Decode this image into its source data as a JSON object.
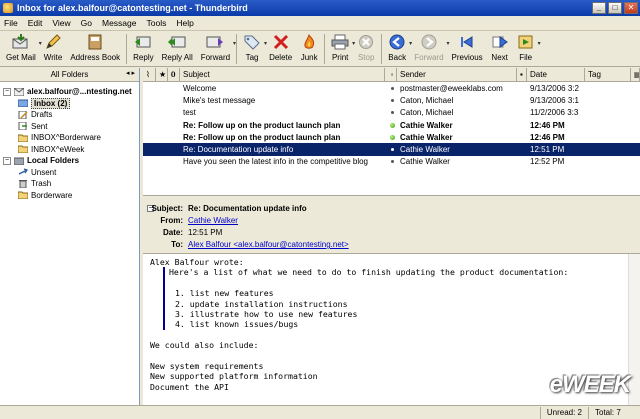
{
  "window": {
    "title": "Inbox for alex.balfour@catontesting.net - Thunderbird",
    "min": "_",
    "max": "□",
    "close": "✕"
  },
  "menu": [
    "File",
    "Edit",
    "View",
    "Go",
    "Message",
    "Tools",
    "Help"
  ],
  "toolbar": {
    "get_mail": "Get Mail",
    "write": "Write",
    "address_book": "Address Book",
    "reply": "Reply",
    "reply_all": "Reply All",
    "forward": "Forward",
    "tag": "Tag",
    "delete": "Delete",
    "junk": "Junk",
    "print": "Print",
    "stop": "Stop",
    "back": "Back",
    "forward_nav": "Forward",
    "previous": "Previous",
    "next": "Next",
    "file": "File"
  },
  "folder_pane": {
    "header": "All Folders",
    "arrows": "◂ ▸",
    "account": "alex.balfour@...ntesting.net",
    "folders": [
      "Inbox (2)",
      "Drafts",
      "Sent",
      "INBOX^Borderware",
      "INBOX^eWeek"
    ],
    "local_header": "Local Folders",
    "local_folders": [
      "Unsent",
      "Trash",
      "Borderware"
    ]
  },
  "message_list": {
    "columns": {
      "subject": "Subject",
      "sender": "Sender",
      "date": "Date",
      "tag": "Tag"
    },
    "rows": [
      {
        "subject": "Welcome",
        "sender": "postmaster@eweeklabs.com",
        "date": "9/13/2006 3:2",
        "unread": false,
        "selected": false,
        "green": false
      },
      {
        "subject": "Mike's test message",
        "sender": "Caton, Michael",
        "date": "9/13/2006 3:1",
        "unread": false,
        "selected": false,
        "green": false
      },
      {
        "subject": "test",
        "sender": "Caton, Michael",
        "date": "11/2/2006 3:3",
        "unread": false,
        "selected": false,
        "green": false
      },
      {
        "subject": "Re: Follow up on the product launch plan",
        "sender": "Cathie Walker",
        "date": "12:46 PM",
        "unread": true,
        "selected": false,
        "green": true
      },
      {
        "subject": "Re: Follow up on the product launch plan",
        "sender": "Cathie Walker",
        "date": "12:46 PM",
        "unread": true,
        "selected": false,
        "green": true
      },
      {
        "subject": "Re: Documentation update info",
        "sender": "Cathie Walker",
        "date": "12:51 PM",
        "unread": false,
        "selected": true,
        "green": false
      },
      {
        "subject": "Have you seen the latest info in the competitive blog",
        "sender": "Cathie Walker",
        "date": "12:52 PM",
        "unread": false,
        "selected": false,
        "green": false
      }
    ]
  },
  "header": {
    "subject_label": "Subject:",
    "subject": "Re: Documentation update info",
    "from_label": "From:",
    "from": "Cathie Walker",
    "date_label": "Date:",
    "date": "12:51 PM",
    "to_label": "To:",
    "to": "Alex Balfour <alex.balfour@catontesting.net>"
  },
  "body": {
    "intro": "Alex Balfour wrote:",
    "quote": [
      "Here's a list of what we need to do to finish updating the product documentation:",
      "",
      "1. list new features",
      "2. update installation instructions",
      "3. illustrate how to use new features",
      "4. list known issues/bugs"
    ],
    "after": [
      "",
      "We could also include:",
      "",
      "New system requirements",
      "New supported platform information",
      "Document the API"
    ]
  },
  "status": {
    "unread": "Unread: 2",
    "total": "Total: 7"
  },
  "watermark": "eWEEK"
}
